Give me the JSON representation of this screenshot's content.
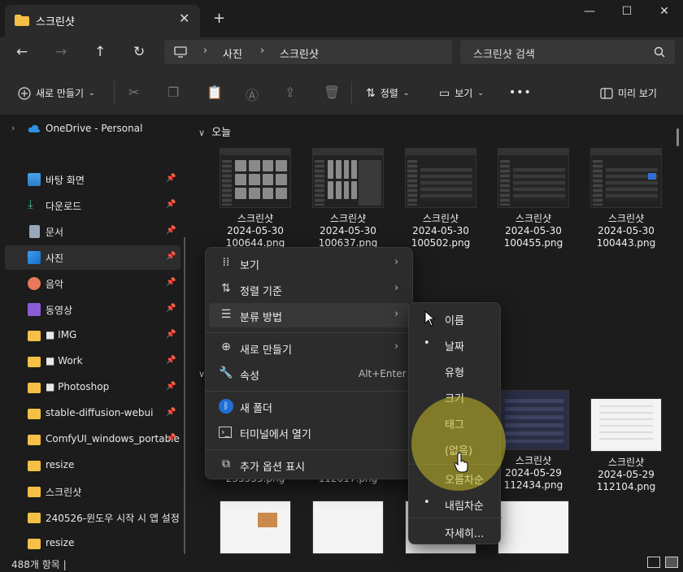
{
  "window": {
    "tab_title": "스크린샷",
    "tab_close": "✕",
    "new_tab": "+",
    "minimize": "—",
    "maximize": "☐",
    "close": "✕"
  },
  "nav": {
    "back": "←",
    "forward": "→",
    "up": "↑",
    "refresh": "↻",
    "breadcrumb": [
      "사진",
      "스크린샷"
    ],
    "sep": "›",
    "search_placeholder": "스크린샷 검색"
  },
  "toolbar": {
    "new_label": "새로 만들기",
    "sort_label": "정렬",
    "view_label": "보기",
    "more_label": "•••",
    "preview_label": "미리 보기"
  },
  "sidebar": {
    "onedrive": "OneDrive - Personal",
    "items": [
      {
        "label": "바탕 화면",
        "icon": "desktop-icon"
      },
      {
        "label": "다운로드",
        "icon": "download-icon"
      },
      {
        "label": "문서",
        "icon": "document-icon"
      },
      {
        "label": "사진",
        "icon": "pictures-icon"
      },
      {
        "label": "음악",
        "icon": "music-icon"
      },
      {
        "label": "동영상",
        "icon": "video-icon"
      },
      {
        "label": "■ IMG",
        "icon": "folder-icon"
      },
      {
        "label": "■ Work",
        "icon": "folder-icon"
      },
      {
        "label": "■ Photoshop",
        "icon": "folder-icon"
      },
      {
        "label": "stable-diffusion-webui",
        "icon": "folder-icon"
      },
      {
        "label": "ComfyUI_windows_portable",
        "icon": "folder-icon"
      },
      {
        "label": "resize",
        "icon": "folder-icon"
      },
      {
        "label": "스크린샷",
        "icon": "folder-icon"
      },
      {
        "label": "240526-윈도우 시작 시 앱 설정",
        "icon": "folder-icon"
      },
      {
        "label": "resize",
        "icon": "folder-icon"
      }
    ]
  },
  "main": {
    "group_today": "오늘",
    "files_row1": [
      {
        "name": "스크린샷",
        "date": "2024-05-30",
        "file": "100644.png"
      },
      {
        "name": "스크린샷",
        "date": "2024-05-30",
        "file": "100637.png"
      },
      {
        "name": "스크린샷",
        "date": "2024-05-30",
        "file": "100502.png"
      },
      {
        "name": "스크린샷",
        "date": "2024-05-30",
        "file": "100455.png"
      },
      {
        "name": "스크린샷",
        "date": "2024-05-30",
        "file": "100443.png"
      }
    ],
    "files_row2": [
      {
        "file": "235555.png"
      },
      {
        "file": "112617.png"
      },
      {
        "name": "스크린샷",
        "date": "2024-05-29",
        "file": "112434.png"
      },
      {
        "name": "스크린샷",
        "date": "2024-05-29",
        "file": "112104.png"
      }
    ]
  },
  "status": {
    "count": "488개 항목  |"
  },
  "context_menu": {
    "view": "보기",
    "sort_by": "정렬 기준",
    "group_by": "분류 방법",
    "new": "새로 만들기",
    "properties": "속성",
    "properties_shortcut": "Alt+Enter",
    "new_folder": "새 폴더",
    "open_terminal": "터미널에서 열기",
    "more_options": "추가 옵션 표시"
  },
  "submenu": {
    "items": [
      "이름",
      "날짜",
      "유형",
      "크기",
      "태그",
      "(없음)"
    ],
    "order": [
      "오름차순",
      "내림차순"
    ],
    "more": "자세히...",
    "bullet": "•"
  },
  "colors": {
    "accent_folder": "#f5c045",
    "highlight": "#c8be28"
  }
}
